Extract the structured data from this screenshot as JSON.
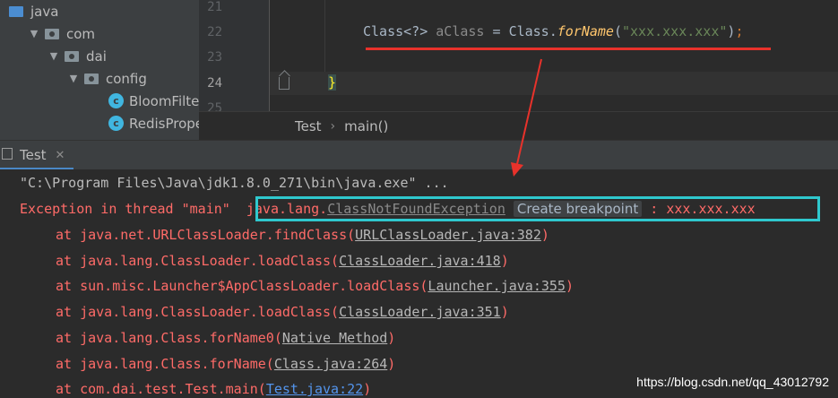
{
  "project_tree": {
    "items": [
      {
        "label": "java",
        "kind": "source-folder"
      },
      {
        "label": "com",
        "kind": "package"
      },
      {
        "label": "dai",
        "kind": "package"
      },
      {
        "label": "config",
        "kind": "package"
      },
      {
        "label": "BloomFilte",
        "kind": "class"
      },
      {
        "label": "RedisPrope",
        "kind": "class"
      }
    ],
    "class_icon_letter": "c"
  },
  "editor": {
    "line_numbers": [
      "21",
      "22",
      "23",
      "24",
      "25"
    ],
    "code_line_22": {
      "type": "Class",
      "generic": "<?>",
      "variable": "aClass",
      "assign": "=",
      "receiver": "Class.",
      "method": "forName",
      "open_paren": "(",
      "string": "\"xxx.xxx.xxx\"",
      "close_paren": ")",
      "semicolon": ";"
    },
    "code_line_24": "}"
  },
  "breadcrumb": {
    "items": [
      "Test",
      "main()"
    ],
    "separator": "›"
  },
  "run_window": {
    "tab_label": "Test",
    "close_glyph": "✕"
  },
  "console": {
    "command_line": "\"C:\\Program Files\\Java\\jdk1.8.0_271\\bin\\java.exe\" ...",
    "exception": {
      "prefix": "Exception in thread \"main\" ",
      "package": "java.lang.",
      "class_name": "ClassNotFoundException",
      "breakpoint_label": "Create breakpoint",
      "message": " : xxx.xxx.xxx"
    },
    "stack": [
      {
        "call": "at java.net.URLClassLoader.findClass(",
        "source": "URLClassLoader.java:382",
        "end": ")"
      },
      {
        "call": "at java.lang.ClassLoader.loadClass(",
        "source": "ClassLoader.java:418",
        "end": ")"
      },
      {
        "call": "at sun.misc.Launcher$AppClassLoader.loadClass(",
        "source": "Launcher.java:355",
        "end": ")"
      },
      {
        "call": "at java.lang.ClassLoader.loadClass(",
        "source": "ClassLoader.java:351",
        "end": ")"
      },
      {
        "call": "at java.lang.Class.forName0(",
        "source": "Native Method",
        "end": ")"
      },
      {
        "call": "at java.lang.Class.forName(",
        "source": "Class.java:264",
        "end": ")"
      },
      {
        "call": "at com.dai.test.Test.main(",
        "source": "Test.java:22",
        "end": ")"
      }
    ]
  },
  "colors": {
    "annotation_red": "#e8322b",
    "highlight_box": "#2fc8ce",
    "error_text": "#ff6b68"
  },
  "watermark": "https://blog.csdn.net/qq_43012792"
}
